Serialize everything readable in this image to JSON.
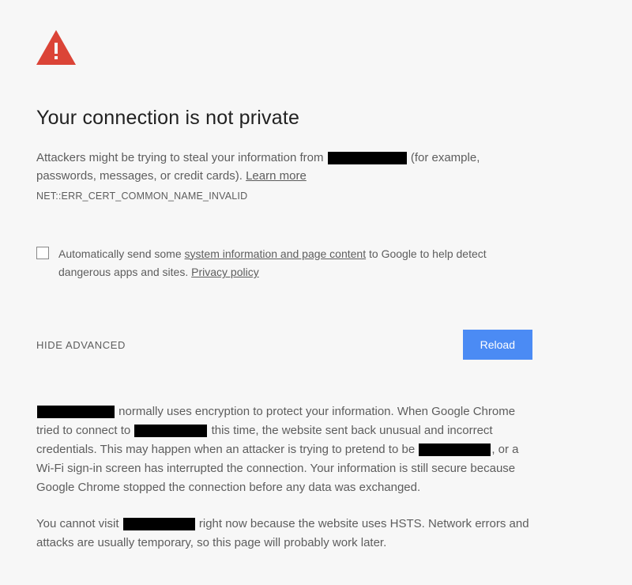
{
  "heading": "Your connection is not private",
  "description": {
    "part1": "Attackers might be trying to steal your information from",
    "part2": "(for example, passwords, messages, or credit cards). ",
    "learn_more": "Learn more"
  },
  "error_code": "NET::ERR_CERT_COMMON_NAME_INVALID",
  "checkbox": {
    "part1": "Automatically send some ",
    "link1": "system information and page content",
    "part2": " to Google to help detect dangerous apps and sites. ",
    "link2": "Privacy policy"
  },
  "actions": {
    "hide_advanced": "HIDE ADVANCED",
    "reload": "Reload"
  },
  "advanced": {
    "para1": {
      "t1": "normally uses encryption to protect your information. When Google Chrome tried to connect to ",
      "t2": " this time, the website sent back unusual and incorrect credentials. This may happen when an attacker is trying to pretend to be ",
      "t3": ", or a Wi-Fi sign-in screen has interrupted the connection. Your information is still secure because Google Chrome stopped the connection before any data was exchanged."
    },
    "para2": {
      "t1": "You cannot visit",
      "t2": " right now because the website uses HSTS. Network errors and attacks are usually temporary, so this page will probably work later."
    }
  }
}
